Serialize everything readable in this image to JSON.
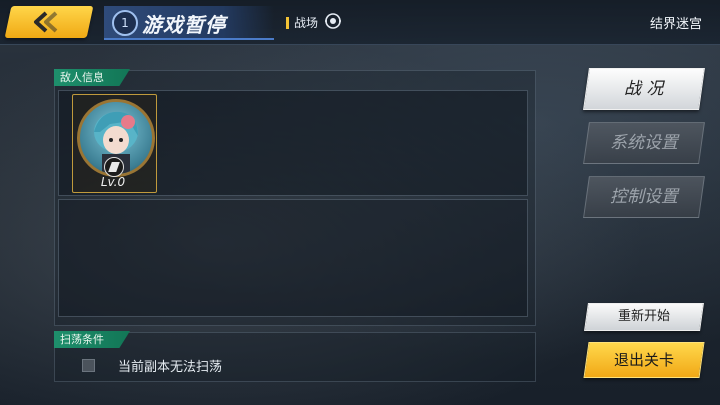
{
  "header": {
    "round_number": "1",
    "title": "游戏暂停",
    "battle_label": "战场",
    "stage_name": "结界迷宫",
    "back_icon": "chevron-left-icon",
    "eye_icon": "eye-icon"
  },
  "enemy_section": {
    "label": "敌人信息",
    "enemies": [
      {
        "level": "Lv.0"
      }
    ]
  },
  "sweep_section": {
    "label": "扫荡条件",
    "condition_text": "当前副本无法扫荡",
    "checked": false
  },
  "right_menu": {
    "battle_status": "战 况",
    "system_settings": "系统设置",
    "control_settings": "控制设置",
    "restart": "重新开始",
    "exit_stage": "退出关卡"
  },
  "colors": {
    "accent_yellow": "#f5bd25",
    "section_green": "#1e8f6c",
    "title_blue": "#2f4b7a"
  }
}
